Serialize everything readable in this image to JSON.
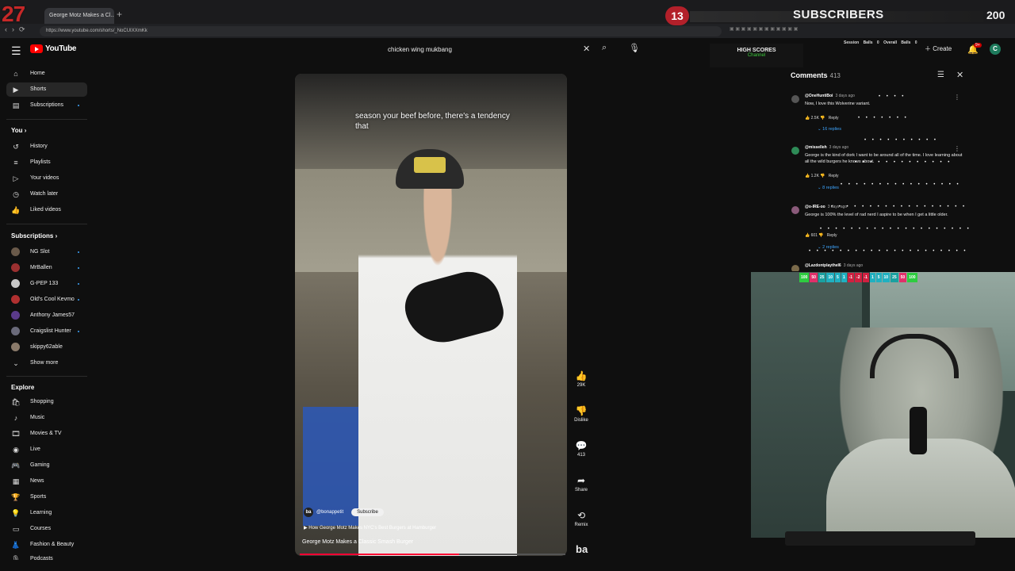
{
  "browser": {
    "tab_title": "George Motz Makes a Cl...",
    "url": "https://www.youtube.com/shorts/_NoCUIXXmKk"
  },
  "overlay": {
    "left_counter": "27",
    "badge": "13",
    "label": "SUBSCRIBERS",
    "goal": "200"
  },
  "header": {
    "logo_text": "YouTube",
    "search_query": "chicken wing mukbang",
    "high_scores_title": "HIGH SCORES",
    "high_scores_sub": "Channel",
    "session_stats": "Session Balls 0 Overall Balls 0",
    "create_label": "Create",
    "notification_count": "9+",
    "avatar_letter": "C"
  },
  "sidebar": {
    "main": [
      {
        "label": "Home",
        "icon": "home-icon"
      },
      {
        "label": "Shorts",
        "icon": "shorts-icon"
      },
      {
        "label": "Subscriptions",
        "icon": "subscriptions-icon"
      }
    ],
    "you_title": "You",
    "you_items": [
      {
        "label": "History",
        "icon": "history-icon"
      },
      {
        "label": "Playlists",
        "icon": "playlists-icon"
      },
      {
        "label": "Your videos",
        "icon": "your-videos-icon"
      },
      {
        "label": "Watch later",
        "icon": "watch-later-icon"
      },
      {
        "label": "Liked videos",
        "icon": "liked-videos-icon"
      }
    ],
    "subs_title": "Subscriptions",
    "subs": [
      {
        "label": "NG Slot",
        "color": "#6a5a4a"
      },
      {
        "label": "MrBallen",
        "color": "#9b3030"
      },
      {
        "label": "G-PEP 133",
        "color": "#c8c8c8"
      },
      {
        "label": "Old's Cool Kevmo",
        "color": "#b03030"
      },
      {
        "label": "Anthony James57",
        "color": "#5a3a8a"
      },
      {
        "label": "Craigslist Hunter",
        "color": "#6a6a7a"
      },
      {
        "label": "skippy62able",
        "color": "#8a7a6a"
      }
    ],
    "show_more": "Show more",
    "explore_title": "Explore",
    "explore": [
      {
        "label": "Shopping",
        "icon": "shopping-icon"
      },
      {
        "label": "Music",
        "icon": "music-icon"
      },
      {
        "label": "Movies & TV",
        "icon": "movies-icon"
      },
      {
        "label": "Live",
        "icon": "live-icon"
      },
      {
        "label": "Gaming",
        "icon": "gaming-icon"
      },
      {
        "label": "News",
        "icon": "news-icon"
      },
      {
        "label": "Sports",
        "icon": "sports-icon"
      },
      {
        "label": "Learning",
        "icon": "learning-icon"
      },
      {
        "label": "Courses",
        "icon": "courses-icon"
      },
      {
        "label": "Fashion & Beauty",
        "icon": "fashion-icon"
      },
      {
        "label": "Podcasts",
        "icon": "podcasts-icon"
      }
    ]
  },
  "video": {
    "caption": "season your beef before, there's a tendency that",
    "channel_logo": "ba",
    "channel_handle": "@bonappetit",
    "subscribe_label": "Subscribe",
    "link_text": "How George Motz Makes NYC's Best Burgers at Hamburger",
    "title": "George Motz Makes a Classic Smash Burger",
    "progress": 0.6
  },
  "actions": {
    "like_count": "29K",
    "dislike_label": "Dislike",
    "comment_count": "413",
    "share_label": "Share",
    "remix_label": "Remix",
    "brand": "ba"
  },
  "comments": {
    "title": "Comments",
    "count": "413",
    "items": [
      {
        "author": "@OneHuntiBoi",
        "time": "3 days ago",
        "text": "Now, I love this Wolverine variant.",
        "likes": "2.5K",
        "replies": "16 replies",
        "avatar_color": "#555555"
      },
      {
        "author": "@misselleh",
        "time": "3 days ago",
        "text": "George is the kind of dork I want to be around all of the time. I love learning about all the wild burgers he knows about.",
        "likes": "1.2K",
        "replies": "8 replies",
        "avatar_color": "#2e8b57"
      },
      {
        "author": "@o-IRE-oo",
        "time": "3 days ago",
        "text": "George is 100% the level of rad nerd I aspire to be when I get a little older.",
        "likes": "601",
        "replies": "2 replies",
        "avatar_color": "#8a5a7a"
      },
      {
        "author": "@LazdontplaytheI6",
        "time": "3 days ago",
        "text": "",
        "likes": "",
        "replies": "",
        "avatar_color": "#7a6a4a"
      }
    ],
    "reply_label": "Reply"
  },
  "cam_bar": [
    {
      "v": "100",
      "c": "#2ecc40"
    },
    {
      "v": "50",
      "c": "#e0306a"
    },
    {
      "v": "25",
      "c": "#1aa0a0"
    },
    {
      "v": "10",
      "c": "#20b0c0"
    },
    {
      "v": "5",
      "c": "#20b0c0"
    },
    {
      "v": "1",
      "c": "#20b0c0"
    },
    {
      "v": "-1",
      "c": "#d02040"
    },
    {
      "v": "-2",
      "c": "#d02040"
    },
    {
      "v": "-1",
      "c": "#d02040"
    },
    {
      "v": "1",
      "c": "#20b0c0"
    },
    {
      "v": "5",
      "c": "#20b0c0"
    },
    {
      "v": "10",
      "c": "#20b0c0"
    },
    {
      "v": "25",
      "c": "#1aa0a0"
    },
    {
      "v": "50",
      "c": "#e0306a"
    },
    {
      "v": "100",
      "c": "#2ecc40"
    }
  ]
}
